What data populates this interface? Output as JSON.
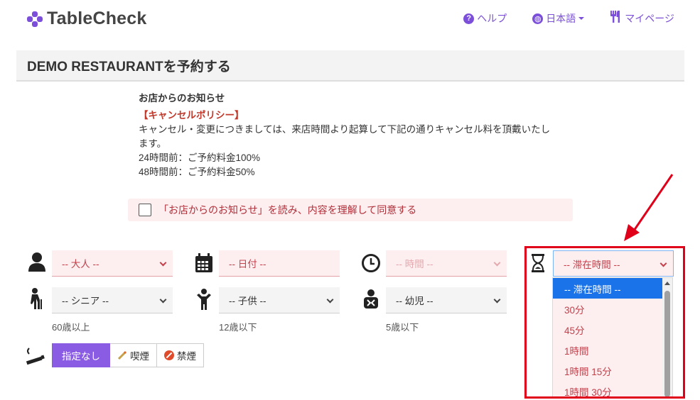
{
  "header": {
    "logo_text": "TableCheck",
    "nav": [
      {
        "label": "ヘルプ",
        "icon": "help-icon"
      },
      {
        "label": "日本語",
        "icon": "globe-icon"
      },
      {
        "label": "マイページ",
        "icon": "fork-knife-icon"
      }
    ]
  },
  "title": "DEMO RESTAURANTを予約する",
  "notice": {
    "heading": "お店からのお知らせ",
    "cancel_title": "【キャンセルポリシー】",
    "body": "キャンセル・変更につきましては、来店時間より起算して下記の通りキャンセル料を頂戴いたします。",
    "line_24h": "24時間前：ご予約料金100%",
    "line_48h": "48時間前：ご予約料金50%"
  },
  "agree": {
    "label": "「お店からのお知らせ」を読み、内容を理解して同意する",
    "checked": false
  },
  "form": {
    "adults": "-- 大人 --",
    "date": "-- 日付 --",
    "time": "-- 時間 --",
    "duration": "-- 滞在時間 --",
    "senior": "-- シニア --",
    "senior_hint": "60歳以上",
    "child": "-- 子供 --",
    "child_hint": "12歳以下",
    "infant": "-- 幼児 --",
    "infant_hint": "5歳以下"
  },
  "smoking": {
    "options": [
      "指定なし",
      "喫煙",
      "禁煙"
    ],
    "selected": "指定なし"
  },
  "duration_dropdown": {
    "options": [
      "-- 滞在時間 --",
      "30分",
      "45分",
      "1時間",
      "1時間 15分",
      "1時間 30分"
    ],
    "selected_index": 0
  },
  "colors": {
    "brand": "#7b4fd9",
    "required_bg": "#fdeef0",
    "required_text": "#c2414b",
    "highlight": "#e0001a",
    "selected_option": "#1a73e8"
  }
}
